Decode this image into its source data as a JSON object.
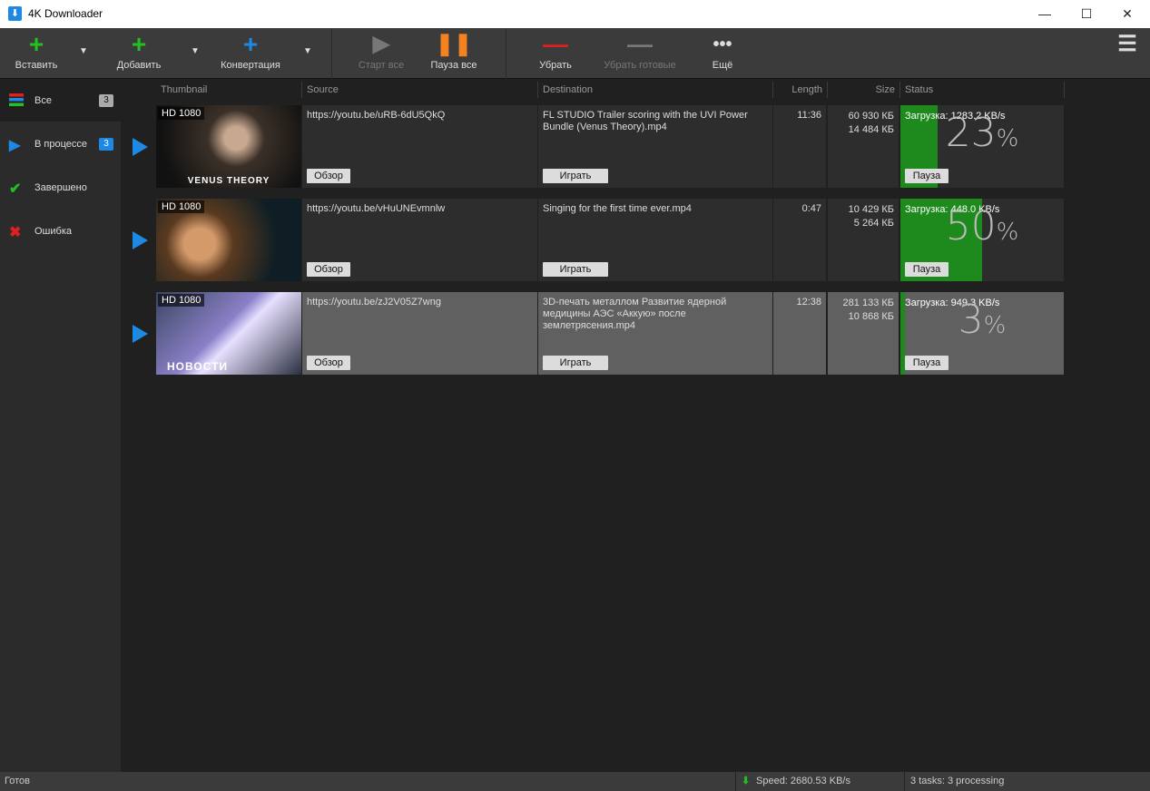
{
  "app": {
    "title": "4K Downloader"
  },
  "toolbar": {
    "paste": "Вставить",
    "add": "Добавить",
    "convert": "Конвертация",
    "start_all": "Старт все",
    "pause_all": "Пауза все",
    "remove": "Убрать",
    "remove_done": "Убрать готовые",
    "more": "Ещё"
  },
  "sidebar": {
    "items": [
      {
        "label": "Все",
        "count": "3"
      },
      {
        "label": "В процессе",
        "count": "3"
      },
      {
        "label": "Завершено"
      },
      {
        "label": "Ошибка"
      }
    ]
  },
  "columns": {
    "thumbnail": "Thumbnail",
    "source": "Source",
    "destination": "Destination",
    "length": "Length",
    "size": "Size",
    "status": "Status"
  },
  "rows": [
    {
      "quality": "HD 1080",
      "caption": "VENUS THEORY",
      "source": "https://youtu.be/uRB-6dU5QkQ",
      "browse": "Обзор",
      "destination": "FL STUDIO   Trailer scoring with the UVI Power Bundle (Venus Theory).mp4",
      "play": "Играть",
      "length": "11:36",
      "size_total": "60 930 КБ",
      "size_done": "14 484 КБ",
      "status": "Загрузка: 1283.2 KB/s",
      "percent": 23,
      "pause": "Пауза"
    },
    {
      "quality": "HD 1080",
      "caption": "",
      "source": "https://youtu.be/vHuUNEvmnlw",
      "browse": "Обзор",
      "destination": "Singing for the first time ever.mp4",
      "play": "Играть",
      "length": "0:47",
      "size_total": "10 429 КБ",
      "size_done": "5 264 КБ",
      "status": "Загрузка: 448.0 KB/s",
      "percent": 50,
      "pause": "Пауза"
    },
    {
      "quality": "HD 1080",
      "caption": "НОВОСТИ",
      "source": "https://youtu.be/zJ2V05Z7wng",
      "browse": "Обзор",
      "destination": "3D-печать металлом   Развитие ядерной медицины   АЭС «Аккую» после землетрясения.mp4",
      "play": "Играть",
      "length": "12:38",
      "size_total": "281 133 КБ",
      "size_done": "10 868 КБ",
      "status": "Загрузка: 949.3 KB/s",
      "percent": 3,
      "pause": "Пауза"
    }
  ],
  "statusbar": {
    "state": "Готов",
    "speed": "Speed: 2680.53 KB/s",
    "tasks": "3 tasks: 3 processing"
  }
}
